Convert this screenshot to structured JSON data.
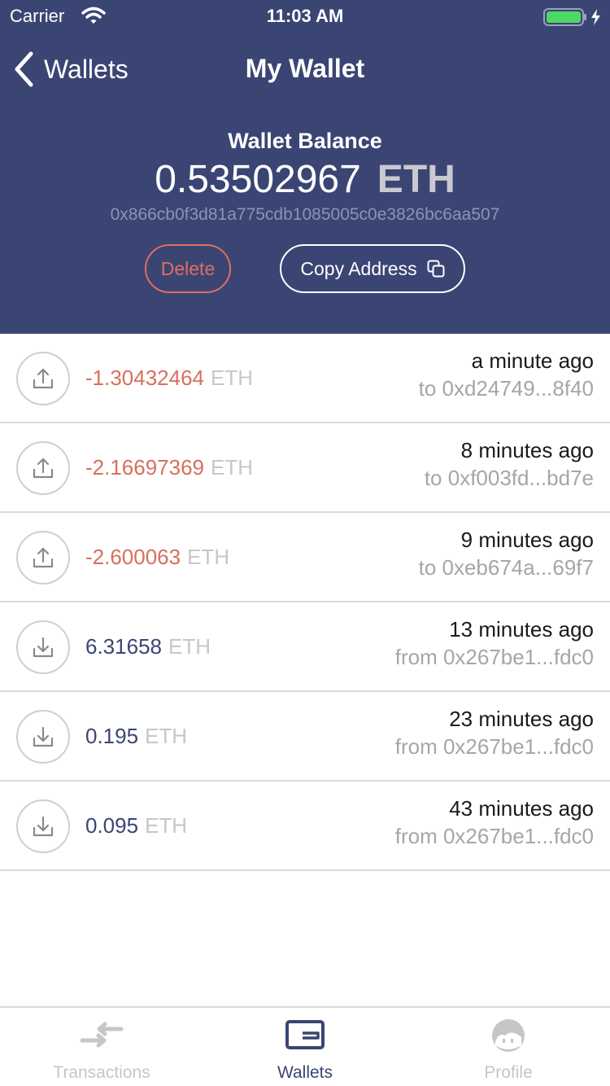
{
  "status_bar": {
    "carrier": "Carrier",
    "time": "11:03 AM"
  },
  "nav": {
    "back_label": "Wallets",
    "title": "My Wallet"
  },
  "wallet": {
    "balance_label": "Wallet Balance",
    "balance": "0.53502967",
    "unit": "ETH",
    "address": "0x866cb0f3d81a775cdb1085005c0e3826bc6aa507",
    "delete_label": "Delete",
    "copy_label": "Copy Address"
  },
  "transactions": [
    {
      "amount": "-1.30432464",
      "unit": "ETH",
      "time": "a minute ago",
      "party": "to 0xd24749...8f40",
      "direction": "out",
      "icon": "upload-icon"
    },
    {
      "amount": "-2.16697369",
      "unit": "ETH",
      "time": "8 minutes ago",
      "party": "to 0xf003fd...bd7e",
      "direction": "out",
      "icon": "upload-icon"
    },
    {
      "amount": "-2.600063",
      "unit": "ETH",
      "time": "9 minutes ago",
      "party": "to 0xeb674a...69f7",
      "direction": "out",
      "icon": "upload-icon"
    },
    {
      "amount": "6.31658",
      "unit": "ETH",
      "time": "13 minutes ago",
      "party": "from 0x267be1...fdc0",
      "direction": "in",
      "icon": "download-icon"
    },
    {
      "amount": "0.195",
      "unit": "ETH",
      "time": "23 minutes ago",
      "party": "from 0x267be1...fdc0",
      "direction": "in",
      "icon": "download-icon"
    },
    {
      "amount": "0.095",
      "unit": "ETH",
      "time": "43 minutes ago",
      "party": "from 0x267be1...fdc0",
      "direction": "in",
      "icon": "download-icon"
    }
  ],
  "tabs": [
    {
      "label": "Transactions",
      "icon": "transfer-arrows-icon",
      "active": false
    },
    {
      "label": "Wallets",
      "icon": "wallet-icon",
      "active": true
    },
    {
      "label": "Profile",
      "icon": "profile-icon",
      "active": false
    }
  ],
  "colors": {
    "header_bg": "#3b4574",
    "outgoing": "#d6705c",
    "incoming": "#3b4574",
    "muted": "#c7c7c7"
  }
}
